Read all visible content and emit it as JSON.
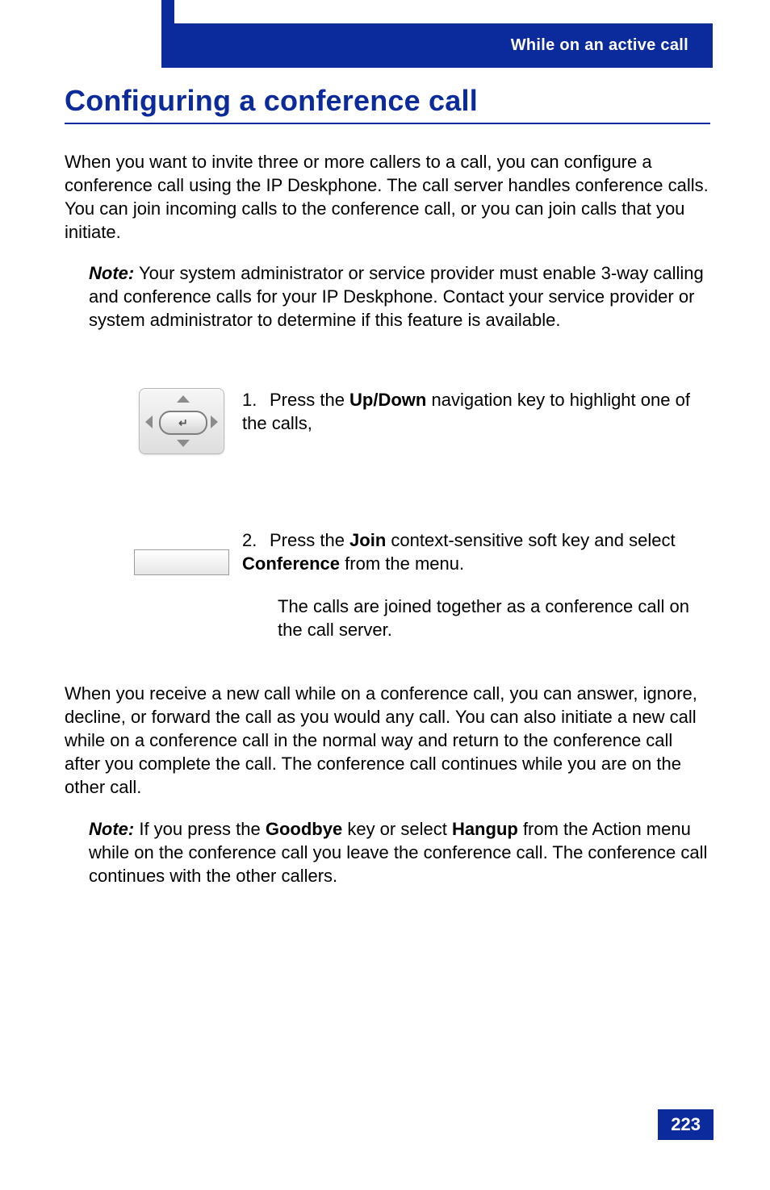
{
  "header": {
    "section_label": "While on an active call"
  },
  "title": "Configuring a conference call",
  "intro": "When you want to invite three or more callers to a call, you can configure a conference call using the IP Deskphone. The call server handles conference calls. You can join incoming calls to the conference call, or you can join calls that you initiate.",
  "note1_label": "Note:",
  "note1_body": "Your system administrator or service provider must enable 3-way calling and conference calls for your IP Deskphone. Contact your service provider or system administrator to determine if this feature is available.",
  "steps": {
    "s1": {
      "num": "1.",
      "pre": "Press the ",
      "key": "Up/Down",
      "post": " navigation key to highlight one of the calls,"
    },
    "s2": {
      "num": "2.",
      "pre": "Press the ",
      "softkey": "Join",
      "mid": " context-sensitive soft key and select ",
      "menuitem": "Conference",
      "post": " from the menu.",
      "result": "The calls are joined together as a conference call on the call server."
    }
  },
  "para2": "When you receive a new call while on a conference call, you can answer, ignore, decline, or forward the call as you would any call. You can also initiate a new call while on a conference call in the normal way and return to the conference call after you complete the call. The conference call continues while you are on the other call.",
  "note2_label": "Note:",
  "note2_pre": "If you press the ",
  "note2_key": "Goodbye",
  "note2_mid": " key or select ",
  "note2_action": "Hangup",
  "note2_post": " from the Action menu while on the conference call you leave the conference call. The conference call continues with the other callers.",
  "page_number": "223"
}
